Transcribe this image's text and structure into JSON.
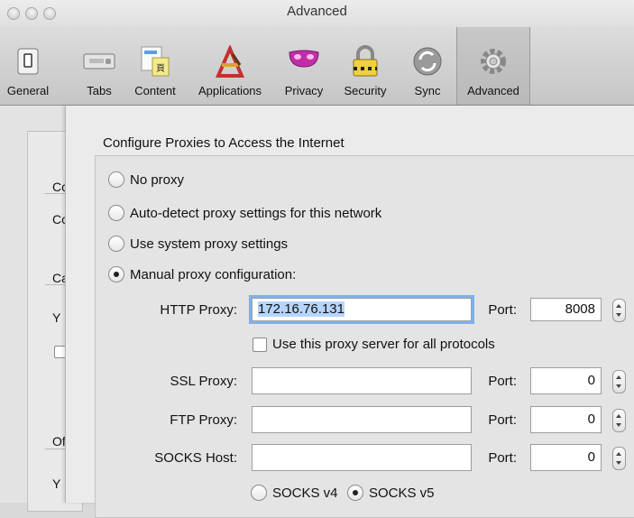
{
  "window": {
    "title": "Advanced"
  },
  "toolbar": {
    "items": [
      {
        "label": "General",
        "icon": "general-switch-icon"
      },
      {
        "label": "Tabs",
        "icon": "tabs-icon"
      },
      {
        "label": "Content",
        "icon": "content-icon"
      },
      {
        "label": "Applications",
        "icon": "applications-icon"
      },
      {
        "label": "Privacy",
        "icon": "privacy-mask-icon"
      },
      {
        "label": "Security",
        "icon": "padlock-icon"
      },
      {
        "label": "Sync",
        "icon": "sync-icon"
      },
      {
        "label": "Advanced",
        "icon": "gear-icon",
        "selected": true
      }
    ]
  },
  "background_panel": {
    "labels": [
      "Cc",
      "Co",
      "Ca",
      "Y",
      "Of",
      "Y"
    ]
  },
  "proxy_dialog": {
    "heading": "Configure Proxies to Access the Internet",
    "options": [
      {
        "label": "No proxy",
        "selected": false
      },
      {
        "label": "Auto-detect proxy settings for this network",
        "selected": false
      },
      {
        "label": "Use system proxy settings",
        "selected": false
      },
      {
        "label": "Manual proxy configuration:",
        "selected": true
      }
    ],
    "http": {
      "label": "HTTP Proxy:",
      "value": "172.16.76.131",
      "port_label": "Port:",
      "port": "8008"
    },
    "all_protocols": {
      "label": "Use this proxy server for all protocols",
      "checked": false
    },
    "ssl": {
      "label": "SSL Proxy:",
      "value": "",
      "port_label": "Port:",
      "port": "0"
    },
    "ftp": {
      "label": "FTP Proxy:",
      "value": "",
      "port_label": "Port:",
      "port": "0"
    },
    "socks": {
      "label": "SOCKS Host:",
      "value": "",
      "port_label": "Port:",
      "port": "0"
    },
    "socks_version": [
      {
        "label": "SOCKS v4",
        "selected": false
      },
      {
        "label": "SOCKS v5",
        "selected": true
      }
    ]
  },
  "colors": {
    "focus_ring": "#7fb1ea",
    "text_selection": "#b5d5ff"
  }
}
